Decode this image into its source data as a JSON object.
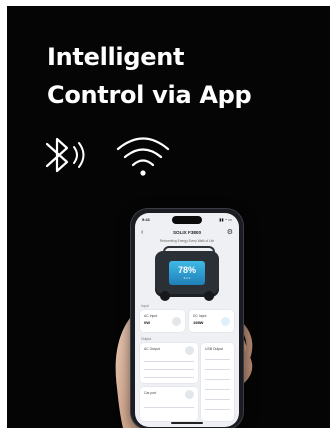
{
  "hero": {
    "line1": "Intelligent",
    "line2": "Control via App"
  },
  "icons": {
    "bluetooth": "bluetooth-icon",
    "wifi": "wifi-icon"
  },
  "phone": {
    "status_time": "9:41",
    "status_right": "▮▮ ◔ ▭",
    "app_title": "SOLIX F3800",
    "tagline": "Reinventing Energy Every Walk of Life",
    "battery_percent": "78%",
    "battery_sub": "6.1 h",
    "input_section": "Input",
    "ac_input_label": "AC Input",
    "ac_input_value": "0W",
    "dc_input_label": "DC Input",
    "dc_input_value": "198W",
    "output_section": "Output",
    "ac_output_label": "AC Output",
    "usb_label": "USB Output",
    "car_port_label": "Car port"
  },
  "colors": {
    "background": "#050505",
    "accent": "#2a9fd8",
    "text": "#ffffff"
  }
}
